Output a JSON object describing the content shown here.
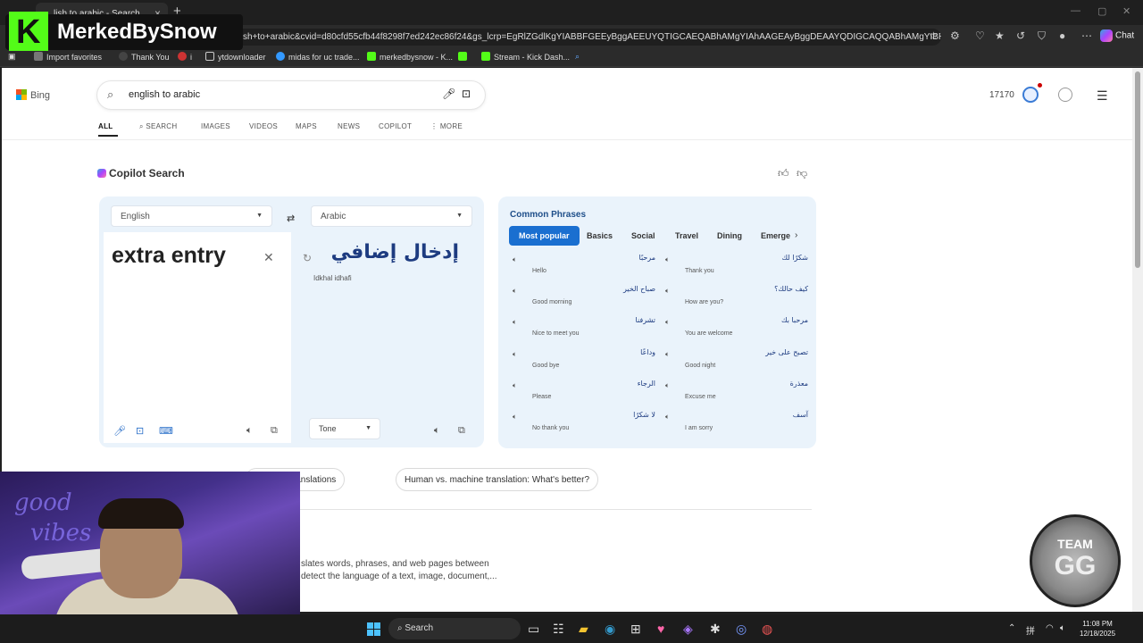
{
  "browser": {
    "tab_title": "lish to arabic - Search",
    "url": "sh+to+arabic&cvid=d80cfd55cfb44f8298f7ed242ec86f24&gs_lcrp=EgRlZGdlKgYIABBFGEEyBggAEEUYQTIGCAEQABhAMgYIAhAAGEAyBggDEAAYQDIGCAQQABhAMgYIBRAAGEAyBgg...",
    "chat_label": "Chat",
    "favorites": [
      "Import favorites",
      "Thank You",
      "i",
      "ytdownloader",
      "midas for uc trade...",
      "merkedbysnow - K...",
      "",
      "Stream - Kick Dash..."
    ]
  },
  "overlay": {
    "logo_text": "MerkedBySnow",
    "badge_line1": "TEAM",
    "badge_line2": "GG",
    "neon_line1": "good",
    "neon_line2": "vibes"
  },
  "bing": {
    "logo": "Bing",
    "query": "english to arabic",
    "points": "17170",
    "tabs": [
      "ALL",
      "SEARCH",
      "IMAGES",
      "VIDEOS",
      "MAPS",
      "NEWS",
      "COPILOT",
      "MORE"
    ]
  },
  "copilot": {
    "title": "Copilot Search"
  },
  "translator": {
    "source_lang": "English",
    "target_lang": "Arabic",
    "source_text": "extra entry",
    "target_text": "إدخال إضافي",
    "transliteration": "Idkhal idhafi",
    "tone_label": "Tone"
  },
  "phrases": {
    "title": "Common Phrases",
    "tabs": [
      "Most popular",
      "Basics",
      "Social",
      "Travel",
      "Dining",
      "Emerge"
    ],
    "items": [
      {
        "ar": "مرحبًا",
        "en": "Hello"
      },
      {
        "ar": "شكرًا لك",
        "en": "Thank you"
      },
      {
        "ar": "صباح الخير",
        "en": "Good morning"
      },
      {
        "ar": "كيف حالك؟",
        "en": "How are you?"
      },
      {
        "ar": "تشرفنا",
        "en": "Nice to meet you"
      },
      {
        "ar": "مرحبا بك",
        "en": "You are welcome"
      },
      {
        "ar": "وداعًا",
        "en": "Good bye"
      },
      {
        "ar": "تصبح على خير",
        "en": "Good night"
      },
      {
        "ar": "الرجاء",
        "en": "Please"
      },
      {
        "ar": "معذرة",
        "en": "Excuse me"
      },
      {
        "ar": "لا شكرًا",
        "en": "No thank you"
      },
      {
        "ar": "آسف",
        "en": "I am sorry"
      }
    ]
  },
  "chips": [
    "accurate translations",
    "Human vs. machine translation: What's better?"
  ],
  "snippet": {
    "line1": "slates words, phrases, and web pages between",
    "line2": "detect the language of a text, image, document,..."
  },
  "taskbar": {
    "search_label": "Search",
    "time": "11:08 PM",
    "date": "12/18/2025"
  }
}
